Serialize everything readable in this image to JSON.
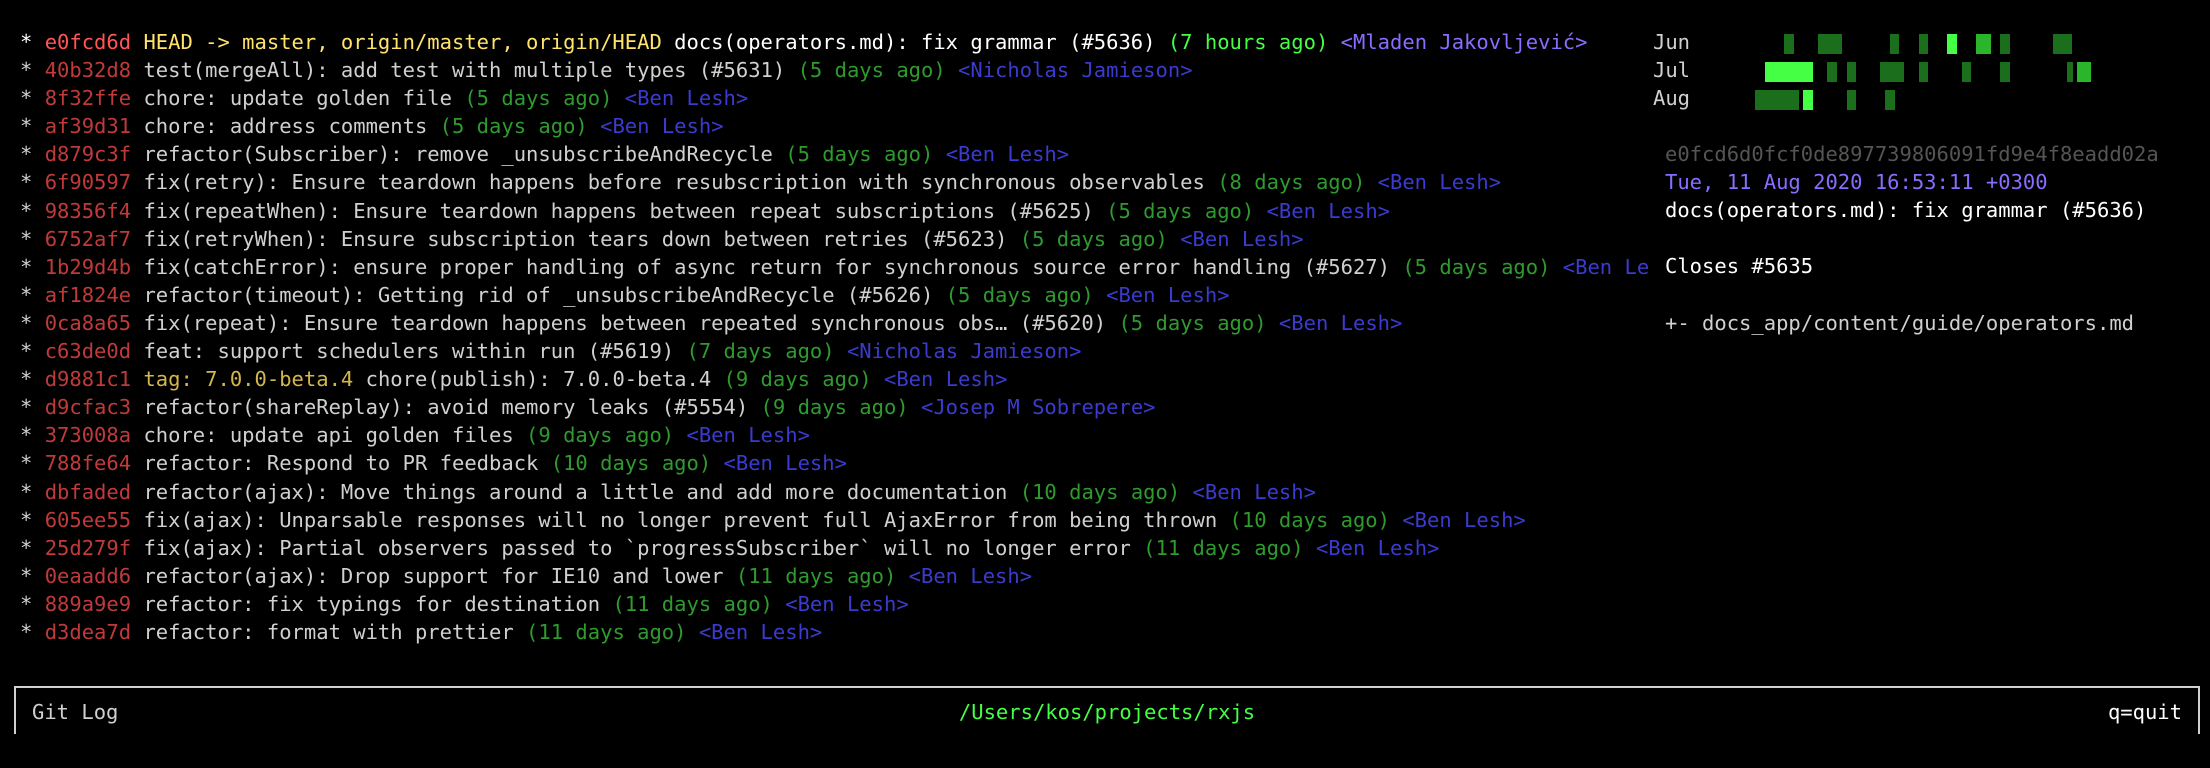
{
  "log": [
    {
      "hash": "e0fcd6d",
      "refs": "HEAD -> master, origin/master, origin/HEAD",
      "subject": "docs(operators.md): fix grammar (#5636)",
      "time": "(7 hours ago)",
      "author": "<Mladen Jakovljević>",
      "selected": true
    },
    {
      "hash": "40b32d8",
      "refs": "",
      "subject": "test(mergeAll): add test with multiple types (#5631)",
      "time": "(5 days ago)",
      "author": "<Nicholas Jamieson>"
    },
    {
      "hash": "8f32ffe",
      "refs": "",
      "subject": "chore: update golden file",
      "time": "(5 days ago)",
      "author": "<Ben Lesh>"
    },
    {
      "hash": "af39d31",
      "refs": "",
      "subject": "chore: address comments",
      "time": "(5 days ago)",
      "author": "<Ben Lesh>"
    },
    {
      "hash": "d879c3f",
      "refs": "",
      "subject": "refactor(Subscriber): remove _unsubscribeAndRecycle",
      "time": "(5 days ago)",
      "author": "<Ben Lesh>"
    },
    {
      "hash": "6f90597",
      "refs": "",
      "subject": "fix(retry): Ensure teardown happens before resubscription with synchronous observables",
      "time": "(8 days ago)",
      "author": "<Ben Lesh>"
    },
    {
      "hash": "98356f4",
      "refs": "",
      "subject": "fix(repeatWhen): Ensure teardown happens between repeat subscriptions (#5625)",
      "time": "(5 days ago)",
      "author": "<Ben Lesh>"
    },
    {
      "hash": "6752af7",
      "refs": "",
      "subject": "fix(retryWhen): Ensure subscription tears down between retries (#5623)",
      "time": "(5 days ago)",
      "author": "<Ben Lesh>"
    },
    {
      "hash": "1b29d4b",
      "refs": "",
      "subject": "fix(catchError): ensure proper handling of async return for synchronous source error handling (#5627)",
      "time": "(5 days ago)",
      "author": "<Ben Lesh>"
    },
    {
      "hash": "af1824e",
      "refs": "",
      "subject": "refactor(timeout): Getting rid of _unsubscribeAndRecycle (#5626)",
      "time": "(5 days ago)",
      "author": "<Ben Lesh>"
    },
    {
      "hash": "0ca8a65",
      "refs": "",
      "subject": "fix(repeat): Ensure teardown happens between repeated synchronous obs… (#5620)",
      "time": "(5 days ago)",
      "author": "<Ben Lesh>"
    },
    {
      "hash": "c63de0d",
      "refs": "",
      "subject": "feat: support schedulers within run (#5619)",
      "time": "(7 days ago)",
      "author": "<Nicholas Jamieson>"
    },
    {
      "hash": "d9881c1",
      "refs": "tag: 7.0.0-beta.4",
      "subject": "chore(publish): 7.0.0-beta.4",
      "time": "(9 days ago)",
      "author": "<Ben Lesh>"
    },
    {
      "hash": "d9cfac3",
      "refs": "",
      "subject": "refactor(shareReplay): avoid memory leaks (#5554)",
      "time": "(9 days ago)",
      "author": "<Josep M Sobrepere>"
    },
    {
      "hash": "373008a",
      "refs": "",
      "subject": "chore: update api golden files",
      "time": "(9 days ago)",
      "author": "<Ben Lesh>"
    },
    {
      "hash": "788fe64",
      "refs": "",
      "subject": "refactor: Respond to PR feedback",
      "time": "(10 days ago)",
      "author": "<Ben Lesh>"
    },
    {
      "hash": "dbfaded",
      "refs": "",
      "subject": "refactor(ajax): Move things around a little and add more documentation",
      "time": "(10 days ago)",
      "author": "<Ben Lesh>"
    },
    {
      "hash": "605ee55",
      "refs": "",
      "subject": "fix(ajax): Unparsable responses will no longer prevent full AjaxError from being thrown",
      "time": "(10 days ago)",
      "author": "<Ben Lesh>"
    },
    {
      "hash": "25d279f",
      "refs": "",
      "subject": "fix(ajax): Partial observers passed to `progressSubscriber` will no longer error",
      "time": "(11 days ago)",
      "author": "<Ben Lesh>"
    },
    {
      "hash": "0eaadd6",
      "refs": "",
      "subject": "refactor(ajax): Drop support for IE10 and lower",
      "time": "(11 days ago)",
      "author": "<Ben Lesh>"
    },
    {
      "hash": "889a9e9",
      "refs": "",
      "subject": "refactor: fix typings for destination",
      "time": "(11 days ago)",
      "author": "<Ben Lesh>"
    },
    {
      "hash": "d3dea7d",
      "refs": "",
      "subject": "refactor: format with prettier",
      "time": "(11 days ago)",
      "author": "<Ben Lesh>"
    }
  ],
  "activity": {
    "months": [
      {
        "label": "Jun",
        "cells": [
          {
            "start": 0.19,
            "len": 0.02,
            "level": 1
          },
          {
            "start": 0.26,
            "len": 0.05,
            "level": 1
          },
          {
            "start": 0.41,
            "len": 0.02,
            "level": 1
          },
          {
            "start": 0.47,
            "len": 0.02,
            "level": 1
          },
          {
            "start": 0.53,
            "len": 0.02,
            "level": 3
          },
          {
            "start": 0.59,
            "len": 0.03,
            "level": 2
          },
          {
            "start": 0.64,
            "len": 0.02,
            "level": 1
          },
          {
            "start": 0.75,
            "len": 0.04,
            "level": 1
          }
        ]
      },
      {
        "label": "Jul",
        "cells": [
          {
            "start": 0.15,
            "len": 0.1,
            "level": 3
          },
          {
            "start": 0.28,
            "len": 0.02,
            "level": 1
          },
          {
            "start": 0.32,
            "len": 0.02,
            "level": 1
          },
          {
            "start": 0.39,
            "len": 0.05,
            "level": 1
          },
          {
            "start": 0.47,
            "len": 0.02,
            "level": 1
          },
          {
            "start": 0.56,
            "len": 0.02,
            "level": 1
          },
          {
            "start": 0.64,
            "len": 0.02,
            "level": 1
          },
          {
            "start": 0.78,
            "len": 0.01,
            "level": 1
          },
          {
            "start": 0.8,
            "len": 0.03,
            "level": 2
          }
        ]
      },
      {
        "label": "Aug",
        "cells": [
          {
            "start": 0.13,
            "len": 0.09,
            "level": 1
          },
          {
            "start": 0.23,
            "len": 0.02,
            "level": 3
          },
          {
            "start": 0.32,
            "len": 0.02,
            "level": 1
          },
          {
            "start": 0.4,
            "len": 0.02,
            "level": 1
          }
        ]
      }
    ],
    "colors": [
      "#0c3a0c",
      "#1b6e1b",
      "#2bb52b",
      "#45ff45"
    ]
  },
  "detail": {
    "hash": "e0fcd6d0fcf0de897739806091fd9e4f8eadd02a",
    "date": "Tue, 11 Aug 2020 16:53:11 +0300",
    "subject": "docs(operators.md): fix grammar (#5636)",
    "body": "Closes #5635",
    "file": "+- docs_app/content/guide/operators.md"
  },
  "statusbar": {
    "left": "Git Log",
    "center": "/Users/kos/projects/rxjs",
    "right": "q=quit"
  }
}
